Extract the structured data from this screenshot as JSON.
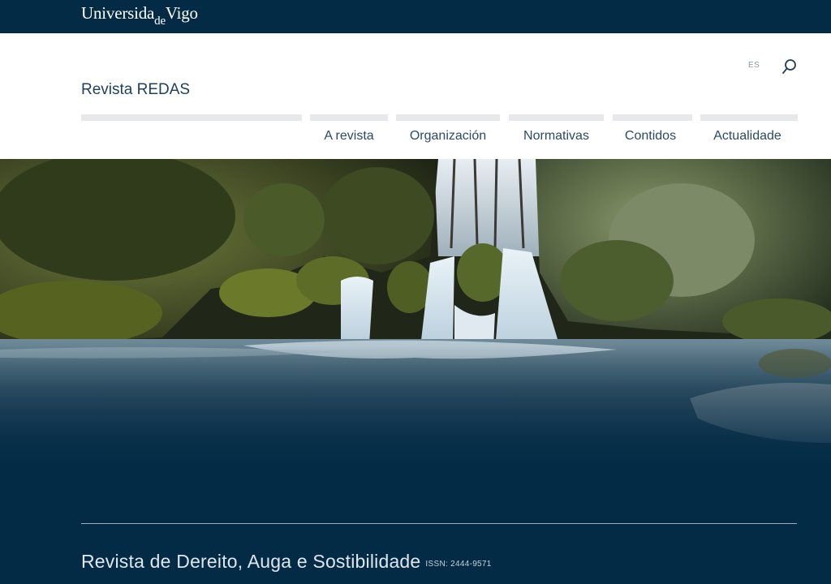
{
  "topbar": {
    "logo_part1": "Universida",
    "logo_part2": "de",
    "logo_part3": "Vigo"
  },
  "header": {
    "site_title": "Revista REDAS",
    "language": "ES",
    "search_icon": "search-icon"
  },
  "nav": {
    "items": [
      {
        "label": "A revista"
      },
      {
        "label": "Organización"
      },
      {
        "label": "Normativas"
      },
      {
        "label": "Contidos"
      },
      {
        "label": "Actualidade"
      }
    ]
  },
  "hero": {
    "image": "waterfall-forest-photo"
  },
  "footer": {
    "title": "Revista de Dereito, Auga e Sostibilidade",
    "issn": "ISSN: 2444-9571"
  },
  "colors": {
    "dark_blue": "#042b45",
    "header_bg": "#ffffff",
    "nav_text": "#2a4a66",
    "bar_gray": "#e6e8ea"
  }
}
